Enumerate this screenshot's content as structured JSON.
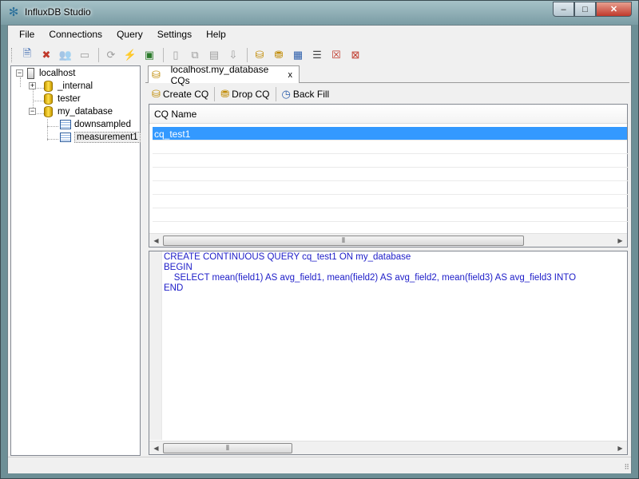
{
  "window": {
    "title": "InfluxDB Studio",
    "minimize": "–",
    "maximize": "□",
    "close": "✕"
  },
  "menu": [
    "File",
    "Connections",
    "Query",
    "Settings",
    "Help"
  ],
  "toolbar_icons": [
    "new-connection-icon",
    "delete-connection-icon",
    "manage-users-icon",
    "connection-properties-icon",
    "refresh-icon",
    "run-query-icon",
    "run-query-on-icon",
    "new-database-icon",
    "copy-icon",
    "paste-icon",
    "export-icon",
    "show-cqs-icon",
    "create-cq-icon",
    "show-measurements-icon",
    "show-series-icon",
    "drop-series-icon",
    "drop-measurement-icon"
  ],
  "tree": {
    "root": "localhost",
    "databases": [
      "_internal",
      "tester",
      "my_database"
    ],
    "measurements": [
      "downsampled",
      "measurement1"
    ]
  },
  "tab": {
    "label": "localhost.my_database CQs",
    "close": "x"
  },
  "cq_toolbar": {
    "create": "Create CQ",
    "drop": "Drop CQ",
    "backfill": "Back Fill"
  },
  "grid": {
    "column": "CQ Name",
    "rows": [
      "cq_test1"
    ]
  },
  "editor": {
    "lines": [
      "CREATE CONTINUOUS QUERY cq_test1 ON my_database",
      "BEGIN",
      "    SELECT mean(field1) AS avg_field1, mean(field2) AS avg_field2, mean(field3) AS avg_field3 INTO",
      "END"
    ]
  },
  "colors": {
    "accent": "#3399ff",
    "code": "#1c1cc8"
  }
}
